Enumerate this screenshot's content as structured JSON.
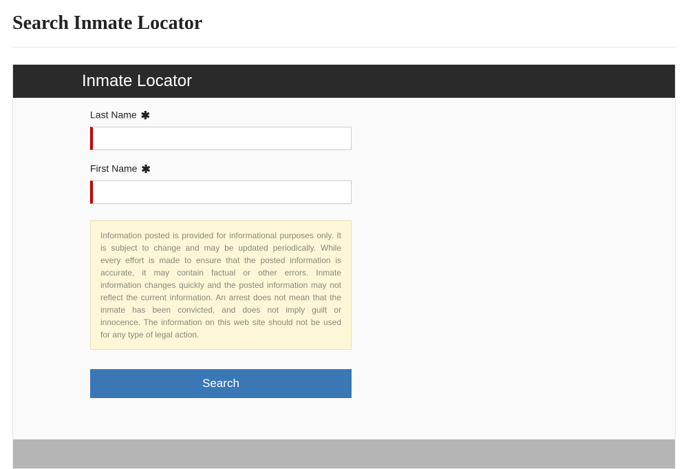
{
  "page": {
    "title": "Search Inmate Locator"
  },
  "app": {
    "header_title": "Inmate Locator"
  },
  "form": {
    "last_name": {
      "label": "Last Name",
      "required_marker": "✱",
      "value": ""
    },
    "first_name": {
      "label": "First Name",
      "required_marker": "✱",
      "value": ""
    },
    "disclaimer_text": "Information posted is provided for informational purposes only. It is subject to change and may be updated periodically. While every effort is made to ensure that the posted information is accurate, it may contain factual or other errors. Inmate information changes quickly and the posted information may not reflect the current information. An arrest does not mean that the inmate has been convicted, and does not imply guilt or innocence. The information on this web site should not be used for any type of legal action.",
    "search_button_label": "Search"
  }
}
